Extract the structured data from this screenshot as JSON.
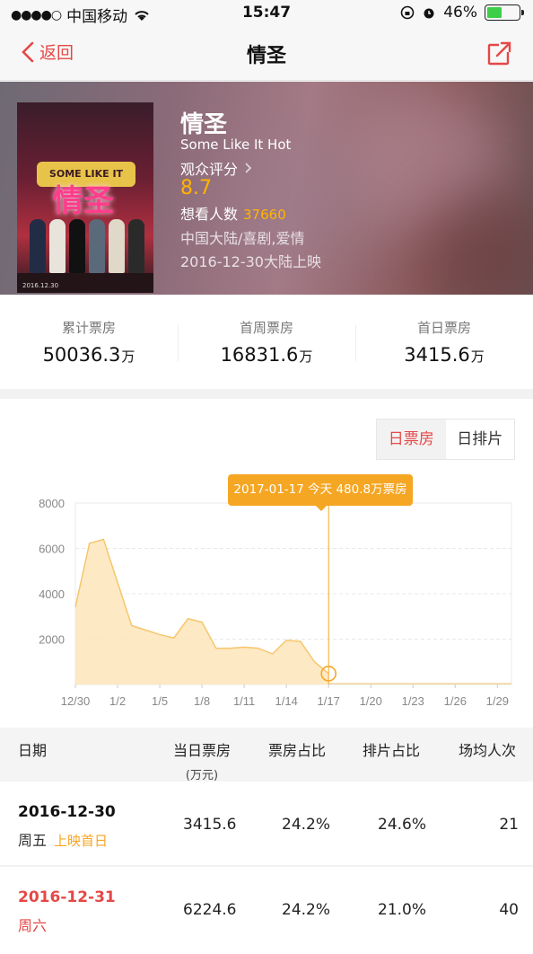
{
  "status_bar": {
    "carrier": "中国移动",
    "time": "15:47",
    "battery": "46%",
    "battery_level": 0.46
  },
  "nav": {
    "back_label": "返回",
    "title": "情圣"
  },
  "movie": {
    "title_cn": "情圣",
    "title_en": "Some Like It Hot",
    "rating_label": "观众评分",
    "rating_score": "8.7",
    "want_label": "想看人数",
    "want_count": "37660",
    "genre": "中国大陆/喜剧,爱情",
    "release": "2016-12-30大陆上映",
    "poster_text": "情圣",
    "poster_sign": "SOME LIKE IT HOT",
    "poster_date": "2016.12.30"
  },
  "stats": [
    {
      "label": "累计票房",
      "value": "50036.3",
      "unit": "万"
    },
    {
      "label": "首周票房",
      "value": "16831.6",
      "unit": "万"
    },
    {
      "label": "首日票房",
      "value": "3415.6",
      "unit": "万"
    }
  ],
  "toggle": {
    "active": "日票房",
    "inactive": "日排片"
  },
  "tooltip": "2017-01-17 今天 480.8万票房",
  "chart_data": {
    "type": "area",
    "y_ticks": [
      "8000",
      "6000",
      "4000",
      "2000"
    ],
    "x_ticks": [
      "12/30",
      "1/2",
      "1/5",
      "1/8",
      "1/11",
      "1/14",
      "1/17",
      "1/20",
      "1/23",
      "1/26",
      "1/29"
    ],
    "ylim": [
      0,
      8000
    ],
    "x_range_days": [
      0,
      31
    ],
    "series": [
      {
        "values": [
          3415.6,
          6224.6,
          6400,
          4500,
          2600,
          2400,
          2200,
          2050,
          2900,
          2750,
          1600,
          1600,
          1650,
          1600,
          1350,
          1950,
          1900,
          1000,
          480.8
        ]
      }
    ],
    "highlight_index": 18,
    "colors": {
      "fill": "#fde5b8",
      "stroke": "#f6c66e",
      "marker": "#f5a623",
      "grid": "#e8e8e8"
    }
  },
  "table": {
    "headers": [
      "日期",
      "当日票房",
      "票房占比",
      "排片占比",
      "场均人次"
    ],
    "unit_sub": "(万元)",
    "rows": [
      {
        "date": "2016-12-30",
        "weekday": "周五",
        "tag": "上映首日",
        "box": "3415.6",
        "box_ratio": "24.2%",
        "show_ratio": "24.6%",
        "avg": "21"
      },
      {
        "date": "2016-12-31",
        "weekday": "周六",
        "tag": "",
        "box": "6224.6",
        "box_ratio": "24.2%",
        "show_ratio": "21.0%",
        "avg": "40"
      }
    ]
  },
  "colors": {
    "accent": "#e54847",
    "highlight": "#f5a623"
  }
}
